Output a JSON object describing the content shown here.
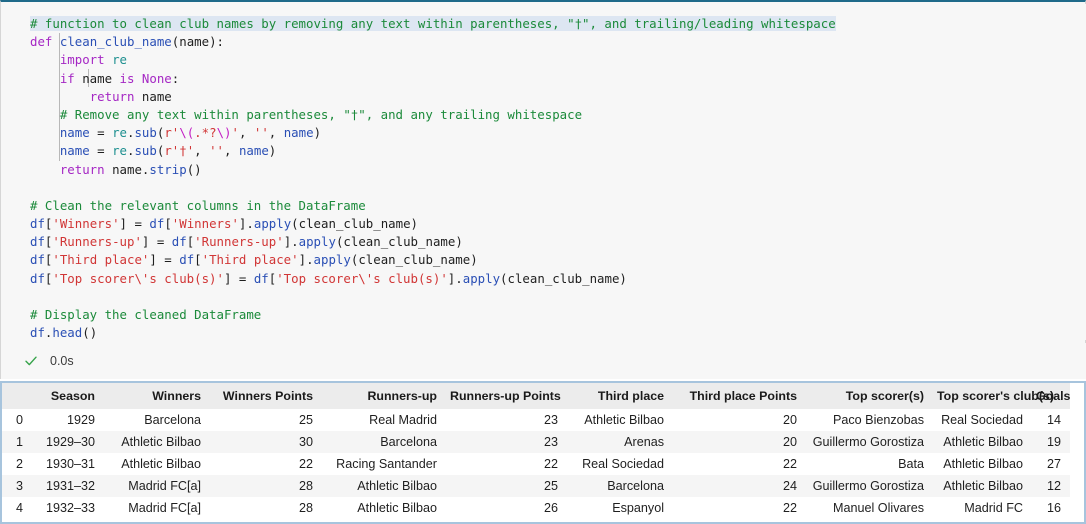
{
  "notebook": {
    "status": {
      "icon": "check-icon",
      "elapsed": "0.0s"
    },
    "code_lines": [
      "# function to clean club names by removing any text within parentheses, \"†\", and trailing/leading whitespace",
      "def clean_club_name(name):",
      "    import re",
      "    if name is None:",
      "        return name",
      "    # Remove any text within parentheses, \"†\", and any trailing whitespace",
      "    name = re.sub(r'\\(.*?\\)', '', name)",
      "    name = re.sub(r'†', '', name)",
      "    return name.strip()",
      "",
      "# Clean the relevant columns in the DataFrame",
      "df['Winners'] = df['Winners'].apply(clean_club_name)",
      "df['Runners-up'] = df['Runners-up'].apply(clean_club_name)",
      "df['Third place'] = df['Third place'].apply(clean_club_name)",
      "df['Top scorer\\'s club(s)'] = df['Top scorer\\'s club(s)'].apply(clean_club_name)",
      "",
      "# Display the cleaned DataFrame",
      "df.head()"
    ]
  },
  "dataframe": {
    "index_header": "",
    "columns": [
      "Season",
      "Winners",
      "Winners Points",
      "Runners-up",
      "Runners-up Points",
      "Third place",
      "Third place Points",
      "Top scorer(s)",
      "Top scorer's club(s)",
      "Goals"
    ],
    "rows": [
      {
        "index": "0",
        "cells": [
          "1929",
          "Barcelona",
          "25",
          "Real Madrid",
          "23",
          "Athletic Bilbao",
          "20",
          "Paco Bienzobas",
          "Real Sociedad",
          "14"
        ]
      },
      {
        "index": "1",
        "cells": [
          "1929–30",
          "Athletic Bilbao",
          "30",
          "Barcelona",
          "23",
          "Arenas",
          "20",
          "Guillermo Gorostiza",
          "Athletic Bilbao",
          "19"
        ]
      },
      {
        "index": "2",
        "cells": [
          "1930–31",
          "Athletic Bilbao",
          "22",
          "Racing Santander",
          "22",
          "Real Sociedad",
          "22",
          "Bata",
          "Athletic Bilbao",
          "27"
        ]
      },
      {
        "index": "3",
        "cells": [
          "1931–32",
          "Madrid FC[a]",
          "28",
          "Athletic Bilbao",
          "25",
          "Barcelona",
          "24",
          "Guillermo Gorostiza",
          "Athletic Bilbao",
          "12"
        ]
      },
      {
        "index": "4",
        "cells": [
          "1932–33",
          "Madrid FC[a]",
          "28",
          "Athletic Bilbao",
          "26",
          "Espanyol",
          "22",
          "Manuel Olivares",
          "Madrid FC",
          "16"
        ]
      }
    ]
  },
  "colors": {
    "cell_background": "#f7f7f7",
    "cell_top_border": "#1f6a8a",
    "output_border": "#a7c4dd",
    "selection_highlight": "#dde6f2",
    "comment": "#1b8a3a",
    "keyword": "#a527c4",
    "string": "#d13636",
    "variable": "#2a4fb5",
    "module": "#1d8f8f",
    "escape": "#c21ec4",
    "header_background": "#ececec",
    "stripe_background": "#f5f5f5",
    "success_check": "#36a34a"
  }
}
